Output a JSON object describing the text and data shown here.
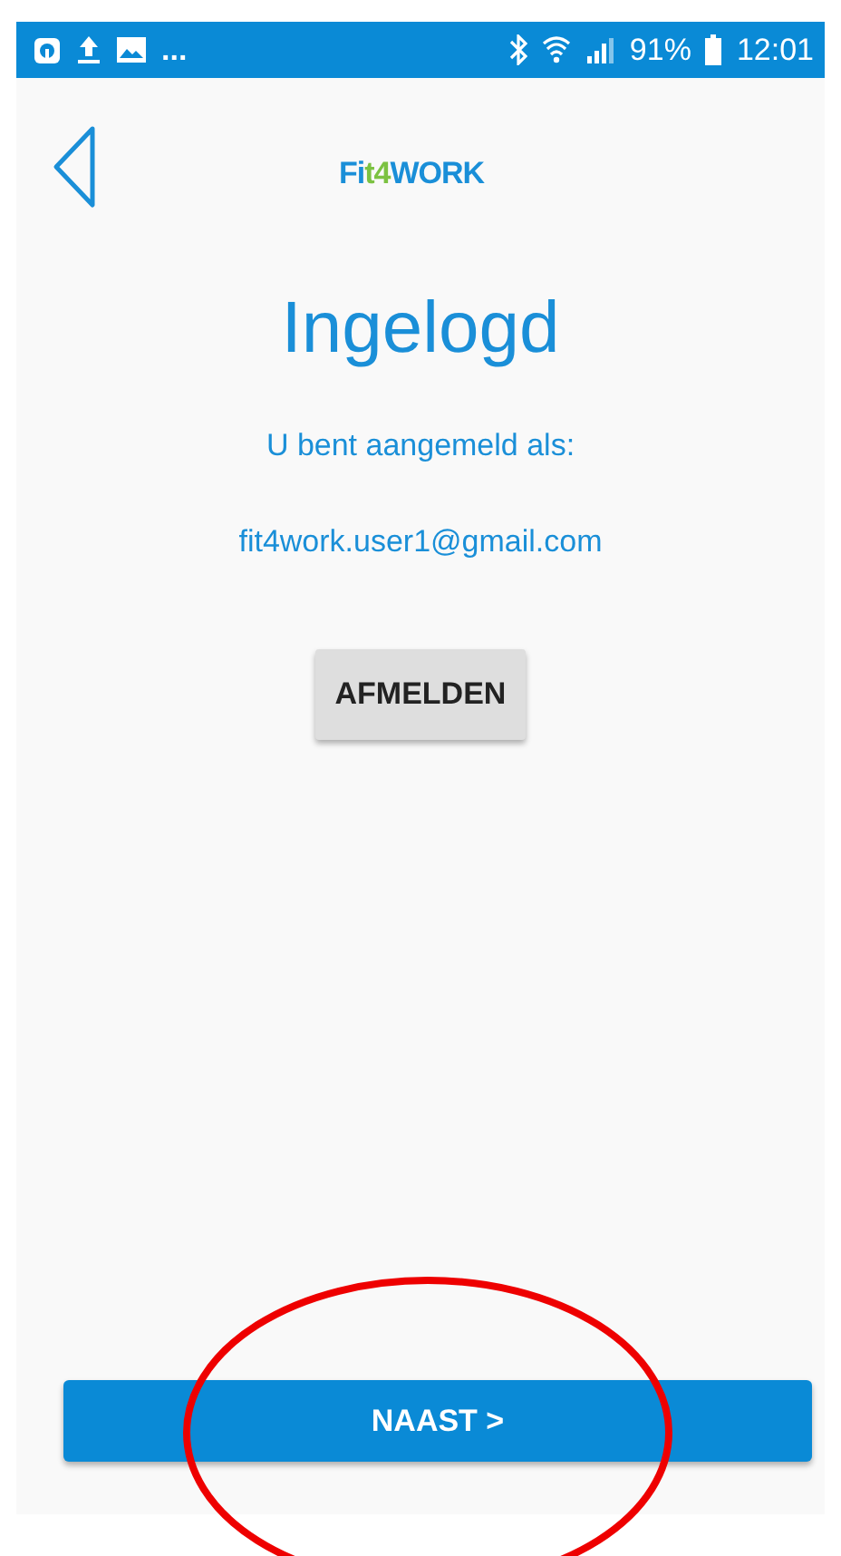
{
  "status_bar": {
    "more": "...",
    "battery": "91%",
    "time": "12:01"
  },
  "header": {
    "logo_parts": [
      {
        "text": "Fi",
        "color": "#1a8fd8"
      },
      {
        "text": "t4",
        "color": "#7cc242"
      },
      {
        "text": "WORK",
        "color": "#1a8fd8"
      }
    ]
  },
  "title": "Ingelogd",
  "subtitle": "U bent aangemeld als:",
  "email": "fit4work.user1@gmail.com",
  "logout_button": "AFMELDEN",
  "next_button": "NAAST >",
  "annotation": {
    "kind": "ellipse",
    "color": "#ee0000"
  }
}
